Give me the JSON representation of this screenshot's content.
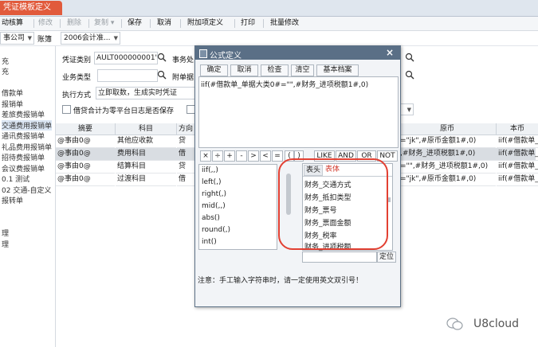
{
  "tabs": {
    "active": "凭证模板定义"
  },
  "toolbar": {
    "items": [
      {
        "label": "动核算"
      },
      {
        "label": "修改"
      },
      {
        "label": "删除"
      },
      {
        "label": "复制 ▾"
      },
      {
        "label": "保存"
      },
      {
        "label": "取消"
      },
      {
        "label": "附加项定义"
      },
      {
        "label": "打印"
      },
      {
        "label": "批量修改"
      }
    ]
  },
  "row2": {
    "company": "事公司",
    "book_label": "账簿",
    "book_value": "2006会计准..."
  },
  "leftnav": {
    "items": [
      "充",
      "充",
      "",
      "借款单",
      "报销单",
      "差旅费报销单",
      "交通费用报销单",
      "通讯费报销单",
      "礼品费用报销单",
      "招待费报销单",
      "会议费报销单",
      "0.1 测试",
      "02 交通-自定义",
      "报转单",
      "",
      "",
      "理",
      "理"
    ]
  },
  "form": {
    "voucher_type_label": "凭证类别",
    "voucher_type_value": "AULT000000001')",
    "affair_label": "事务处",
    "business_type_label": "业务类型",
    "attach_label": "附单据",
    "exec_mode_label": "执行方式",
    "exec_mode_value": "立即取数，生成实时凭证",
    "zero_log_label": "借贷合计为零平台日志是否保存"
  },
  "grid": {
    "headers": [
      "摘要",
      "科目",
      "方向",
      "原币",
      "本币"
    ],
    "rows": [
      {
        "summary": "@事由0@",
        "subject": "其他应收款",
        "dir": "贷",
        "orig": "=\"jk\",#原币金额1#,0)",
        "local": "iif(#借款单_"
      },
      {
        "summary": "@事由0@",
        "subject": "费用科目",
        "dir": "借",
        "orig": ",#财务_进项税额1#,0)",
        "local": "iif(#借款单_"
      },
      {
        "summary": "@事由0@",
        "subject": "结算科目",
        "dir": "贷",
        "orig": "=\"\",#财务_进项税额1#,0)",
        "local": "iif(#借款单_"
      },
      {
        "summary": "@事由0@",
        "subject": "过渡科目",
        "dir": "借",
        "orig": "=\"jk\",#原币金额1#,0)",
        "local": "iif(#借款单_"
      }
    ]
  },
  "dialog": {
    "title": "公式定义",
    "close": "×",
    "buttons": [
      "确定",
      "取消",
      "检查",
      "清空",
      "基本档案"
    ],
    "expression": "iif(#借款单_单据大类0#=\"\",#财务_进项税额1#,0)",
    "operators": [
      "×",
      "÷",
      "+",
      "-",
      ">",
      "<",
      "=",
      "(",
      ")",
      "LIKE",
      "AND",
      "OR",
      "NOT"
    ],
    "functions": [
      "iif(,,)",
      "left(,)",
      "right(,)",
      "mid(,,)",
      "abs()",
      "round(,)",
      "int()"
    ],
    "field_tabs": [
      "表头",
      "表体"
    ],
    "fields": [
      "财务_交通方式",
      "财务_抵扣类型",
      "财务_票号",
      "财务_票面金额",
      "财务_税率",
      "财务_进项税额"
    ],
    "locate_button": "定位",
    "note": "注意：手工输入字符串时，请一定使用英文双引号！"
  },
  "watermark": {
    "text": "U8cloud"
  }
}
